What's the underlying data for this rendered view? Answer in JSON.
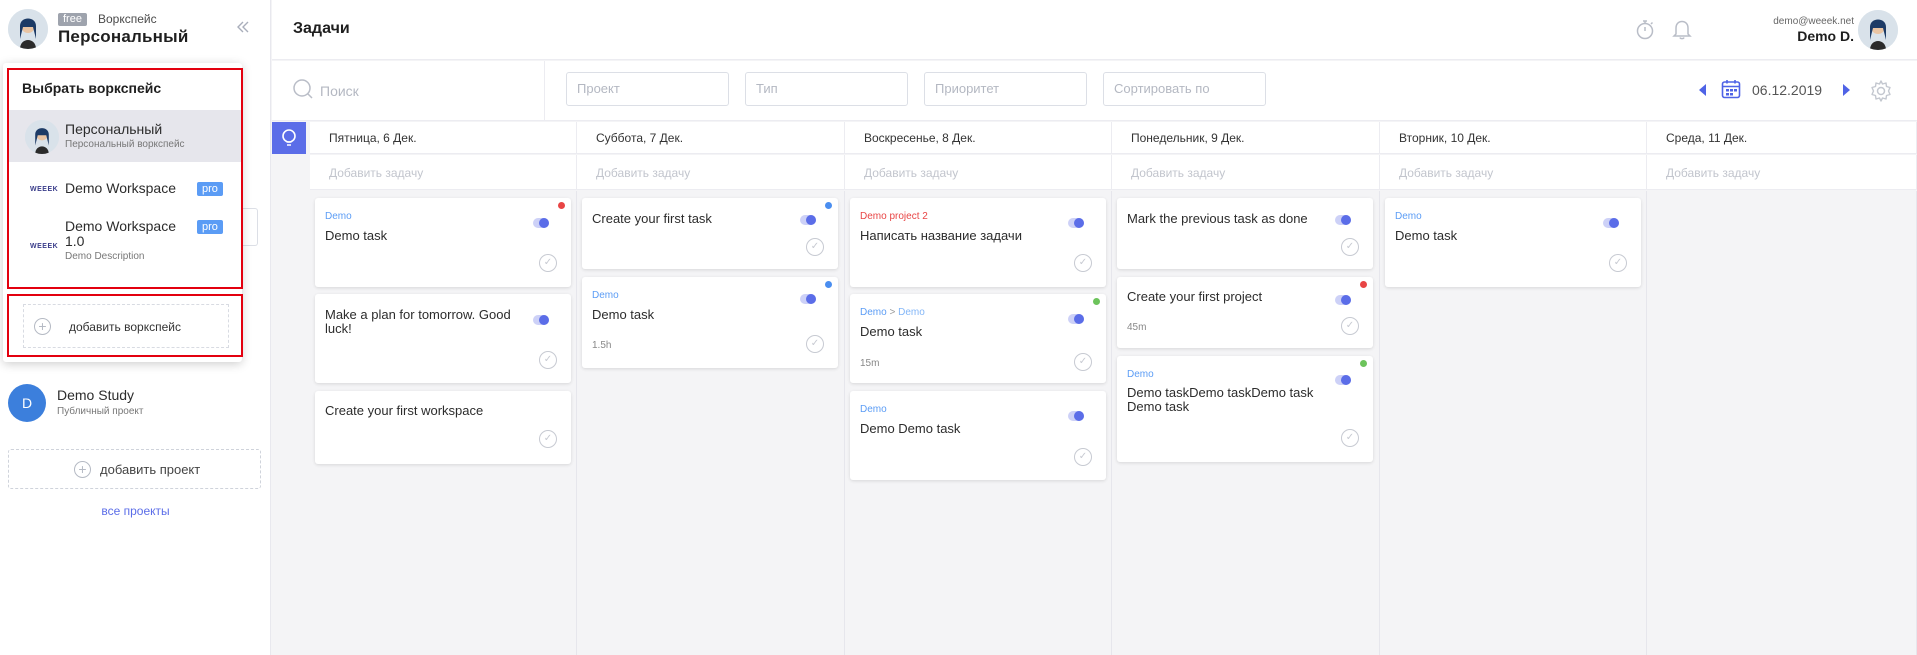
{
  "workspace": {
    "plan_badge": "free",
    "caption": "Воркспейс",
    "name": "Персональный"
  },
  "sidebar": {
    "project": {
      "initial": "D",
      "name": "Demo Study",
      "type": "Публичный проект"
    },
    "add_project": "добавить проект",
    "all_projects": "все проекты"
  },
  "dropdown": {
    "title": "Выбрать воркспейс",
    "items": [
      {
        "name": "Персональный",
        "desc": "Персональный воркспейс"
      },
      {
        "name": "Demo Workspace",
        "badge": "pro",
        "logo": "WEEEK"
      },
      {
        "name": "Demo Workspace",
        "name2": "1.0",
        "badge": "pro",
        "desc": "Demo Description",
        "logo": "WEEEK"
      }
    ],
    "add_workspace": "добавить воркспейс"
  },
  "header": {
    "title": "Задачи",
    "user_email": "demo@weeek.net",
    "user_name": "Demo D."
  },
  "filters": {
    "search_placeholder": "Поиск",
    "project": "Проект",
    "type": "Тип",
    "priority": "Приоритет",
    "sort": "Сортировать по",
    "date": "06.12.2019"
  },
  "board": {
    "add_task": "Добавить задачу",
    "days": [
      {
        "label": "Пятница, 6 Дек."
      },
      {
        "label": "Суббота, 7 Дек."
      },
      {
        "label": "Воскресенье, 8 Дек."
      },
      {
        "label": "Понедельник, 9 Дек."
      },
      {
        "label": "Вторник, 10 Дек."
      },
      {
        "label": "Среда, 11 Дек."
      }
    ],
    "cards": {
      "fri1": {
        "project": "Demo",
        "title": "Demo task"
      },
      "fri2": {
        "title": "Make a plan for tomorrow. Good luck!"
      },
      "fri3": {
        "title": "Create your first workspace"
      },
      "sat1": {
        "title": "Create your first task"
      },
      "sat2": {
        "project": "Demo",
        "title": "Demo task",
        "time": "1.5h"
      },
      "sun1": {
        "project": "Demo project 2",
        "title": "Написать название задачи"
      },
      "sun2": {
        "project": "Demo",
        "sep": " > ",
        "subproject": "Demo",
        "title": "Demo task",
        "time": "15m"
      },
      "sun3": {
        "project": "Demo",
        "title": "Demo Demo task"
      },
      "mon1": {
        "title": "Mark the previous task as done"
      },
      "mon2": {
        "title": "Create your first project",
        "time": "45m"
      },
      "mon3": {
        "project": "Demo",
        "title": "Demo taskDemo taskDemo task Demo task"
      },
      "tue1": {
        "project": "Demo",
        "title": "Demo task"
      }
    }
  },
  "colors": {
    "accent": "#5b6de8",
    "priority_red": "#e84545",
    "priority_blue": "#4a8ef0",
    "priority_green": "#6cc35b",
    "project_red": "#e84545"
  }
}
